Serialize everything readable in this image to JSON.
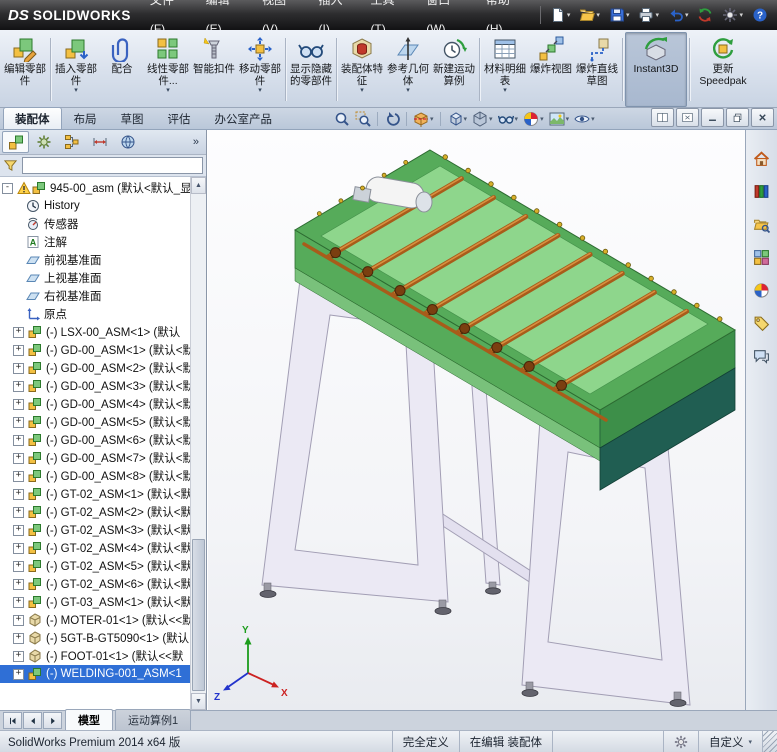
{
  "titlebar": {
    "logo_ds": "DS",
    "logo_text": "SOLIDWORKS"
  },
  "menubar": {
    "items": [
      {
        "name": "menu-file",
        "label": "文件(F)"
      },
      {
        "name": "menu-edit",
        "label": "编辑(E)"
      },
      {
        "name": "menu-view",
        "label": "视图(V)"
      },
      {
        "name": "menu-insert",
        "label": "插入(I)"
      },
      {
        "name": "menu-tools",
        "label": "工具(T)"
      },
      {
        "name": "menu-window",
        "label": "窗口(W)"
      },
      {
        "name": "menu-help",
        "label": "帮助(H)"
      }
    ]
  },
  "quickbar": {
    "items": [
      {
        "name": "new-document-button",
        "icon": "new-doc-icon",
        "dropdown": true
      },
      {
        "name": "open-button",
        "icon": "open-folder-icon",
        "dropdown": true
      },
      {
        "name": "save-button",
        "icon": "save-icon",
        "dropdown": true
      },
      {
        "name": "print-button",
        "icon": "print-icon",
        "dropdown": true
      },
      {
        "name": "undo-button",
        "icon": "undo-icon",
        "dropdown": true
      },
      {
        "name": "rebuild-button",
        "icon": "rebuild-icon",
        "dropdown": false
      },
      {
        "name": "options-button",
        "icon": "options-icon",
        "dropdown": true
      },
      {
        "name": "help-button",
        "icon": "help-icon",
        "dropdown": false
      }
    ]
  },
  "ribbon": {
    "buttons": [
      {
        "name": "edit-component-button",
        "label": "编辑零部件",
        "icon": "edit-component-icon"
      },
      {
        "name": "insert-components-button",
        "label": "插入零部件",
        "icon": "insert-component-icon",
        "dropdown": true
      },
      {
        "name": "mate-button",
        "label": "配合",
        "icon": "mate-icon"
      },
      {
        "name": "linear-component-pattern-button",
        "label": "线性零部件...",
        "icon": "linear-pattern-icon",
        "dropdown": true
      },
      {
        "name": "smart-fasteners-button",
        "label": "智能扣件",
        "icon": "smart-fasteners-icon"
      },
      {
        "name": "move-component-button",
        "label": "移动零部件",
        "icon": "move-component-icon",
        "dropdown": true
      },
      {
        "name": "show-hidden-components-button",
        "label": "显示隐藏的零部件",
        "icon": "show-hidden-icon"
      },
      {
        "name": "assembly-features-button",
        "label": "装配体特征",
        "icon": "assembly-features-icon",
        "dropdown": true
      },
      {
        "name": "reference-geometry-button",
        "label": "参考几何体",
        "icon": "reference-geometry-icon",
        "dropdown": true
      },
      {
        "name": "new-motion-study-button",
        "label": "新建运动算例",
        "icon": "motion-study-icon"
      },
      {
        "name": "bill-of-materials-button",
        "label": "材料明细表",
        "icon": "bom-icon",
        "dropdown": true
      },
      {
        "name": "exploded-view-button",
        "label": "爆炸视图",
        "icon": "exploded-view-icon"
      },
      {
        "name": "explode-line-sketch-button",
        "label": "爆炸直线草图",
        "icon": "explode-sketch-icon"
      },
      {
        "name": "instant3d-button",
        "label": "Instant3D",
        "icon": "instant3d-icon",
        "pressed": true,
        "wide": true
      },
      {
        "name": "update-speedpak-button",
        "label": "更新 Speedpak",
        "icon": "speedpak-icon",
        "wide": true
      }
    ],
    "separators": [
      0,
      5,
      6,
      9,
      12,
      13
    ],
    "tabs": [
      {
        "name": "tab-assembly",
        "label": "装配体",
        "active": true
      },
      {
        "name": "tab-layout",
        "label": "布局"
      },
      {
        "name": "tab-sketch",
        "label": "草图"
      },
      {
        "name": "tab-evaluate",
        "label": "评估"
      },
      {
        "name": "tab-office-products",
        "label": "办公室产品"
      }
    ]
  },
  "viewbar": {
    "items": [
      {
        "name": "zoom-fit-button",
        "icon": "zoom-fit-icon"
      },
      {
        "name": "zoom-area-button",
        "icon": "zoom-area-icon"
      },
      {
        "sep": true
      },
      {
        "name": "previous-view-button",
        "icon": "previous-view-icon"
      },
      {
        "sep": true
      },
      {
        "name": "section-view-button",
        "icon": "section-view-icon",
        "dropdown": true
      },
      {
        "sep": true
      },
      {
        "name": "view-orientation-button",
        "icon": "view-orientation-icon",
        "dropdown": true
      },
      {
        "name": "display-style-button",
        "icon": "display-style-icon",
        "dropdown": true
      },
      {
        "name": "hide-show-items-button",
        "icon": "hide-show-icon",
        "dropdown": true
      },
      {
        "name": "edit-appearance-button",
        "icon": "edit-appearance-icon",
        "dropdown": true
      },
      {
        "name": "apply-scene-button",
        "icon": "apply-scene-icon",
        "dropdown": true
      },
      {
        "name": "view-settings-button",
        "icon": "view-settings-icon",
        "dropdown": true
      }
    ]
  },
  "window_controls": [
    {
      "name": "pane-split-button",
      "icon": "pane-split-icon"
    },
    {
      "name": "pane-close-button",
      "icon": "pane-close-icon"
    },
    {
      "name": "doc-minimize-button",
      "icon": "minimize-icon"
    },
    {
      "name": "doc-restore-button",
      "icon": "restore-icon"
    },
    {
      "name": "doc-close-button",
      "icon": "close-icon"
    }
  ],
  "panel": {
    "tabs": [
      {
        "name": "tab-featuremanager",
        "icon": "featuremanager-tab-icon",
        "active": true
      },
      {
        "name": "tab-propertymanager",
        "icon": "propertymanager-tab-icon"
      },
      {
        "name": "tab-configurationmanager",
        "icon": "configurationmanager-tab-icon"
      },
      {
        "name": "tab-dimxpertmanager",
        "icon": "dimxpert-tab-icon"
      },
      {
        "name": "tab-displaymanager",
        "icon": "displaymanager-tab-icon"
      }
    ],
    "overflow_label": "»",
    "filter": {
      "icon": "filter-funnel-icon",
      "value": ""
    }
  },
  "tree": {
    "root": {
      "label": "945-00_asm (默认<默认_显...",
      "icons": [
        "warning-icon",
        "assembly-icon"
      ]
    },
    "items": [
      {
        "icon": "history-icon",
        "label": "History"
      },
      {
        "icon": "sensors-icon",
        "label": "传感器"
      },
      {
        "icon": "annotations-icon",
        "label": "注解"
      },
      {
        "icon": "plane-icon",
        "label": "前视基准面"
      },
      {
        "icon": "plane-icon",
        "label": "上视基准面"
      },
      {
        "icon": "plane-icon",
        "label": "右视基准面"
      },
      {
        "icon": "origin-icon",
        "label": "原点"
      },
      {
        "icon": "assembly-icon",
        "label": "(-) LSX-00_ASM<1> (默认",
        "exp": true
      },
      {
        "icon": "assembly-icon",
        "label": "(-) GD-00_ASM<1> (默认<默",
        "exp": true
      },
      {
        "icon": "assembly-icon",
        "label": "(-) GD-00_ASM<2> (默认<默",
        "exp": true
      },
      {
        "icon": "assembly-icon",
        "label": "(-) GD-00_ASM<3> (默认<默",
        "exp": true
      },
      {
        "icon": "assembly-icon",
        "label": "(-) GD-00_ASM<4> (默认<默",
        "exp": true
      },
      {
        "icon": "assembly-icon",
        "label": "(-) GD-00_ASM<5> (默认<默",
        "exp": true
      },
      {
        "icon": "assembly-icon",
        "label": "(-) GD-00_ASM<6> (默认<默",
        "exp": true
      },
      {
        "icon": "assembly-icon",
        "label": "(-) GD-00_ASM<7> (默认<默",
        "exp": true
      },
      {
        "icon": "assembly-icon",
        "label": "(-) GD-00_ASM<8> (默认<默",
        "exp": true
      },
      {
        "icon": "assembly-icon",
        "label": "(-) GT-02_ASM<1> (默认<默",
        "exp": true
      },
      {
        "icon": "assembly-icon",
        "label": "(-) GT-02_ASM<2> (默认<默",
        "exp": true
      },
      {
        "icon": "assembly-icon",
        "label": "(-) GT-02_ASM<3> (默认<默",
        "exp": true
      },
      {
        "icon": "assembly-icon",
        "label": "(-) GT-02_ASM<4> (默认<默",
        "exp": true
      },
      {
        "icon": "assembly-icon",
        "label": "(-) GT-02_ASM<5> (默认<默",
        "exp": true
      },
      {
        "icon": "assembly-icon",
        "label": "(-) GT-02_ASM<6> (默认<默",
        "exp": true
      },
      {
        "icon": "assembly-icon",
        "label": "(-) GT-03_ASM<1> (默认<默",
        "exp": true
      },
      {
        "icon": "part-icon",
        "label": "(-) MOTER-01<1> (默认<<默",
        "exp": true
      },
      {
        "icon": "part-icon",
        "label": "(-) 5GT-B-GT5090<1> (默认",
        "exp": true
      },
      {
        "icon": "part-icon",
        "label": "(-) FOOT-01<1> (默认<<默",
        "exp": true
      },
      {
        "icon": "assembly-icon",
        "label": "(-) WELDING-001_ASM<1",
        "exp": true,
        "selected": true
      }
    ]
  },
  "taskpane": {
    "items": [
      {
        "name": "taskpane-resources",
        "icon": "sw-resources-icon"
      },
      {
        "name": "taskpane-design-library",
        "icon": "design-library-icon"
      },
      {
        "name": "taskpane-file-explorer",
        "icon": "file-explorer-icon"
      },
      {
        "name": "taskpane-view-palette",
        "icon": "view-palette-icon"
      },
      {
        "name": "taskpane-appearances",
        "icon": "appearances-icon"
      },
      {
        "name": "taskpane-custom-properties",
        "icon": "custom-properties-icon"
      },
      {
        "name": "taskpane-forum",
        "icon": "forum-icon"
      }
    ]
  },
  "viewport": {
    "triad": {
      "x": "X",
      "y": "Y",
      "z": "Z"
    }
  },
  "model": {
    "deck_top": "#8ed68c",
    "rail": "#56ab5a",
    "rail_dark": "#3d8f49",
    "side_panel": "#205e52",
    "roller": "#a85c1a",
    "roller_hi": "#d89040",
    "frame": "#ebe9f4",
    "frame_edge": "#a29eb4",
    "foot": "#63636d",
    "motor": "#f4f4f4",
    "bolt": "#d8b02a"
  },
  "bottom_tabs": {
    "nav": [
      {
        "name": "pane-first-button",
        "icon": "nav-first-icon"
      },
      {
        "name": "pane-prev-button",
        "icon": "nav-prev-icon"
      },
      {
        "name": "pane-next-button",
        "icon": "nav-next-icon"
      }
    ],
    "items": [
      {
        "name": "tab-model",
        "label": "模型",
        "active": true
      },
      {
        "name": "tab-motion-study-1",
        "label": "运动算例1"
      }
    ]
  },
  "statusbar": {
    "left": "SolidWorks Premium 2014 x64 版",
    "segments": [
      {
        "name": "status-defined",
        "text": "完全定义",
        "interactable": false
      },
      {
        "name": "status-editing",
        "text": "在编辑 装配体",
        "interactable": false
      },
      {
        "name": "status-settings-button",
        "icon": "status-gear-icon",
        "interactable": true
      },
      {
        "name": "status-custom-button",
        "text": "自定义",
        "dropdown": true,
        "interactable": true
      }
    ]
  }
}
